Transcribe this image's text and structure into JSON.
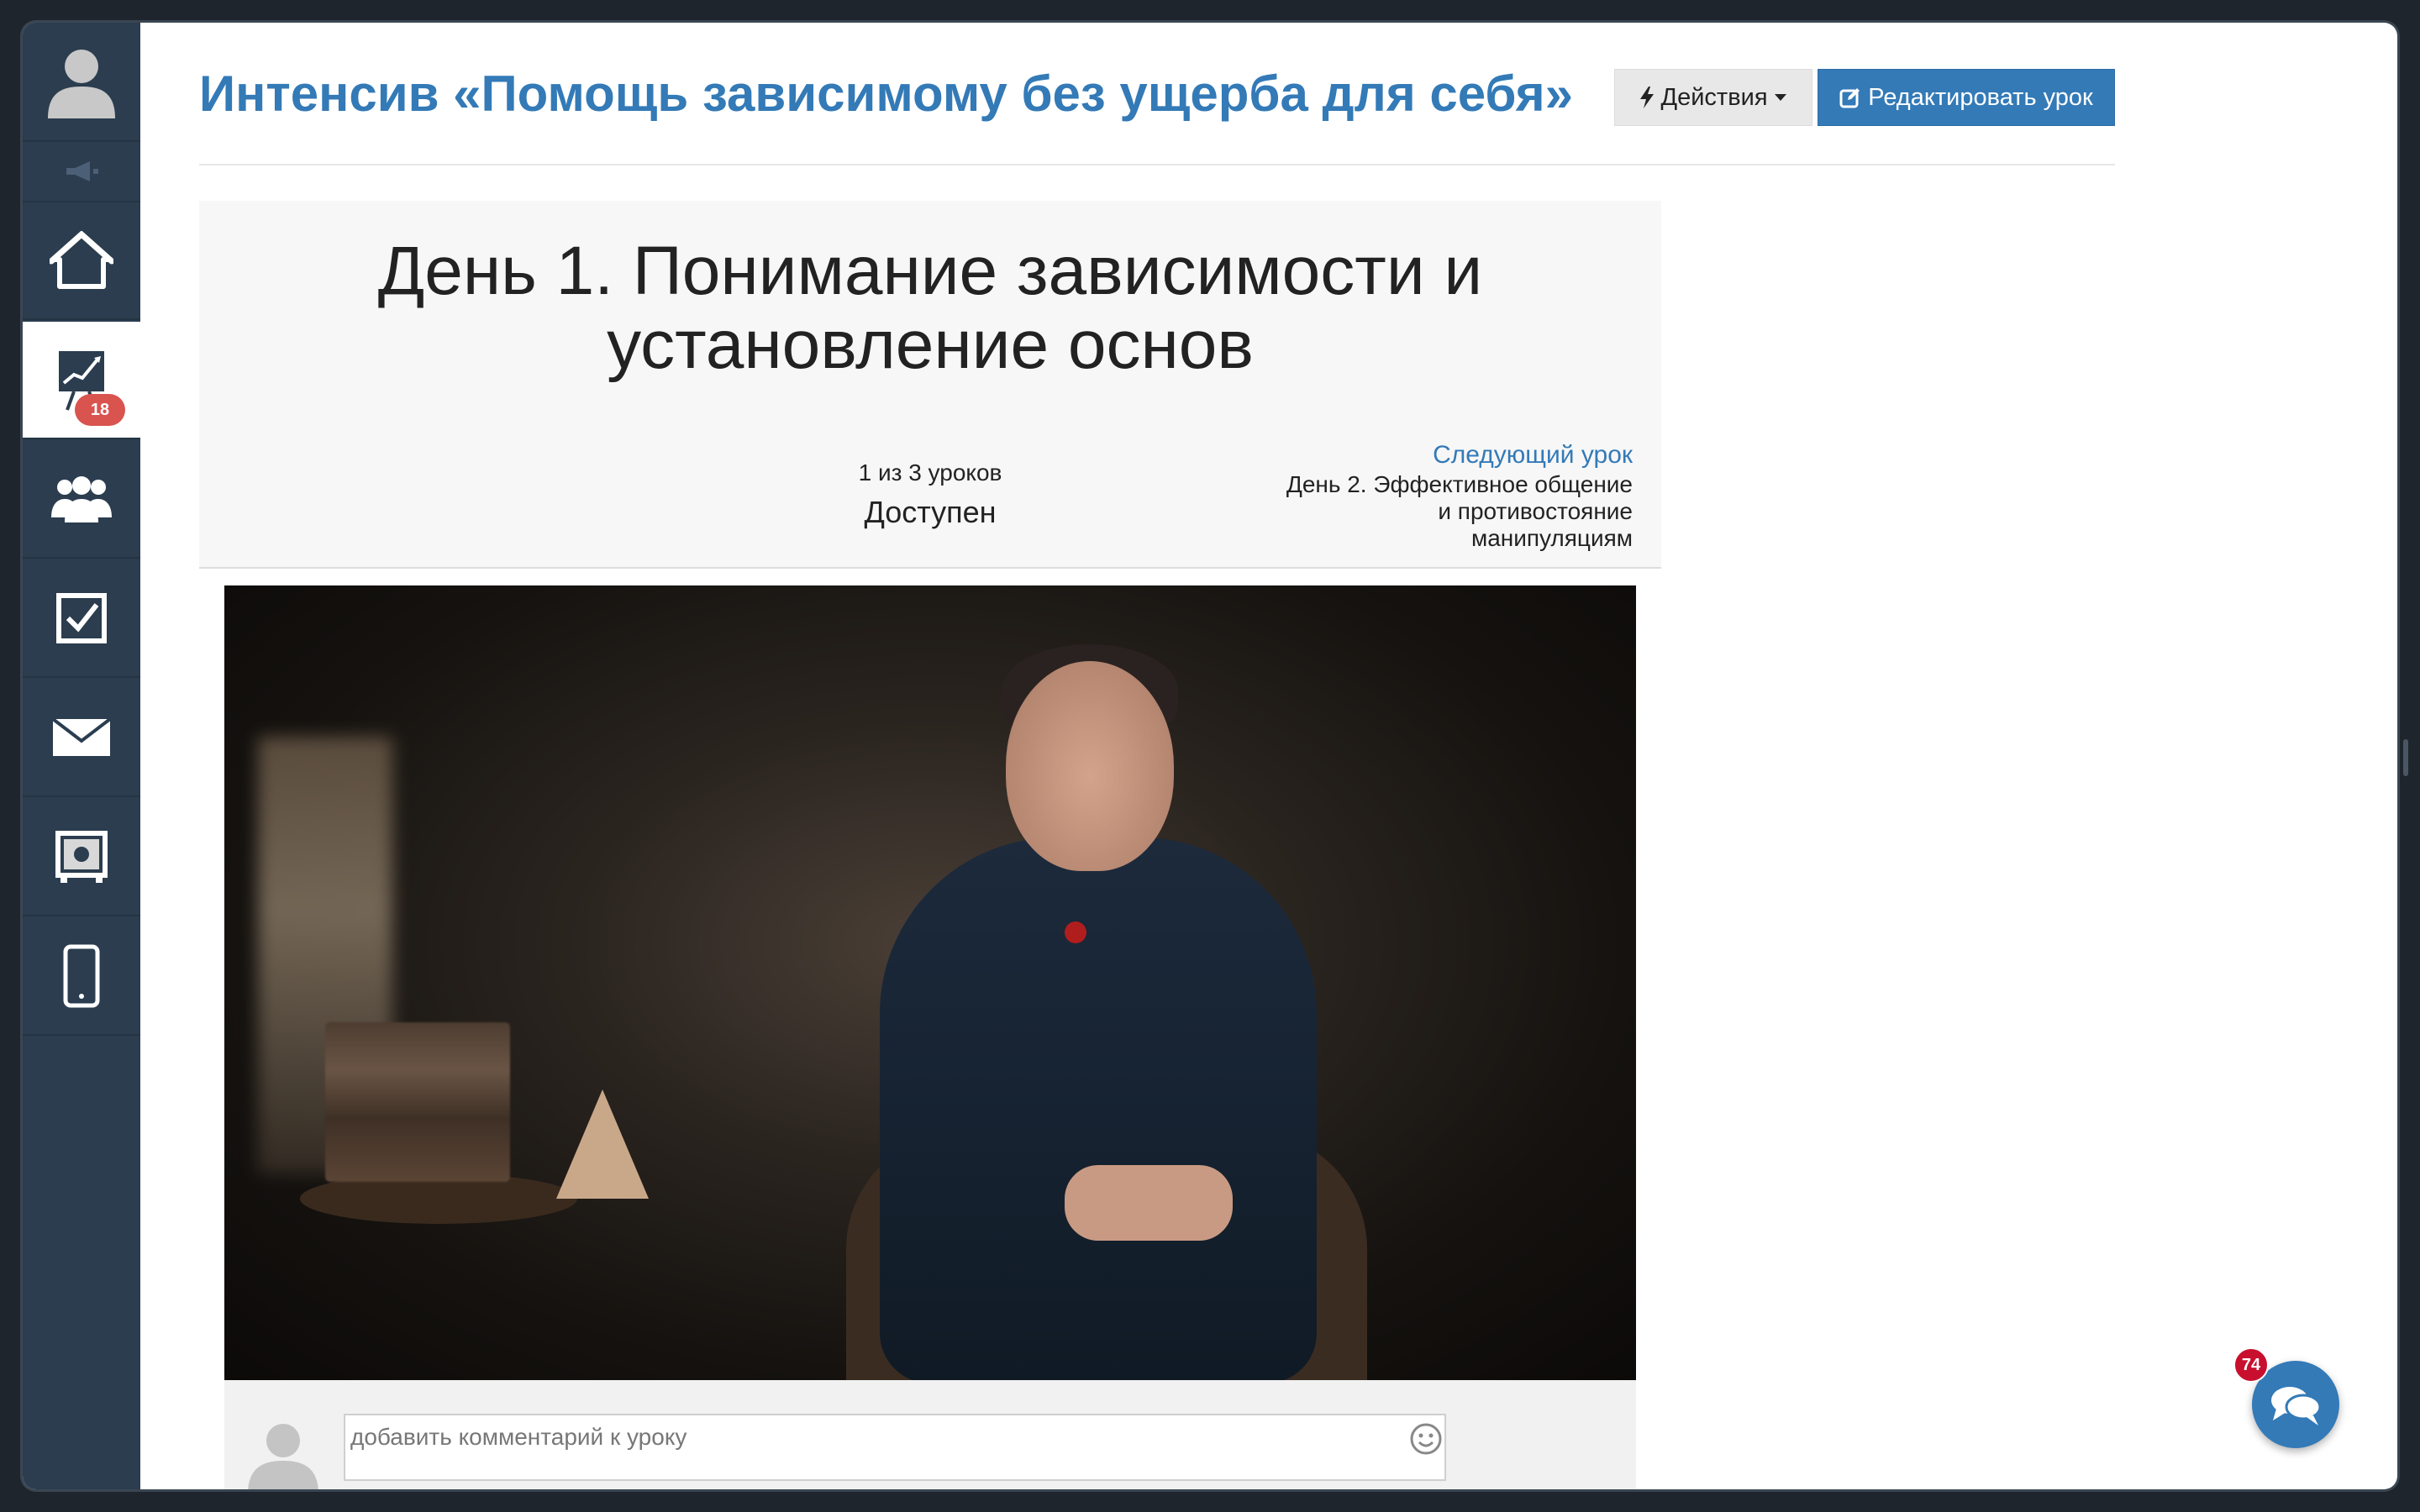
{
  "header": {
    "title": "Интенсив «Помощь зависимому без ущерба для себя»",
    "actions_label": "Действия",
    "edit_label": "Редактировать урок"
  },
  "sidebar": {
    "items": [
      {
        "name": "avatar"
      },
      {
        "name": "sound-icon"
      },
      {
        "name": "home-icon"
      },
      {
        "name": "stats-icon",
        "badge": "18",
        "active": true
      },
      {
        "name": "users-icon"
      },
      {
        "name": "tasks-icon"
      },
      {
        "name": "mail-icon"
      },
      {
        "name": "safe-icon"
      },
      {
        "name": "mobile-icon"
      }
    ]
  },
  "lesson": {
    "title": "День 1. Понимание зависимости и установление основ",
    "count": "1 из 3 уроков",
    "status": "Доступен",
    "next_link": "Следующий урок",
    "next_title": "День 2. Эффективное общение и противостояние манипуляциям"
  },
  "comment": {
    "placeholder": "добавить комментарий к уроку"
  },
  "chat": {
    "badge": "74"
  },
  "colors": {
    "accent": "#337ab7",
    "sidebar": "#2b3d4f",
    "badge": "#d9534f"
  }
}
